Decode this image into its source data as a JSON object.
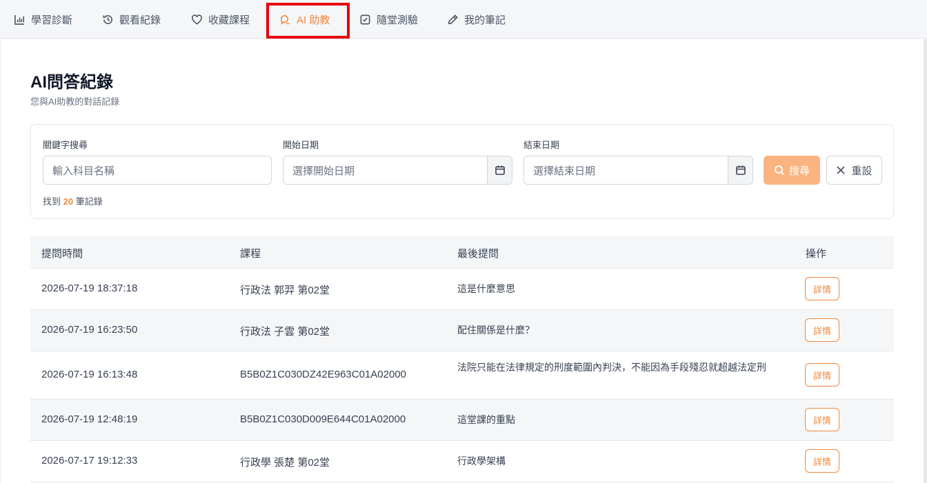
{
  "tabs": [
    {
      "label": "學習診斷",
      "icon": "bar-chart-icon",
      "active": false
    },
    {
      "label": "觀看紀錄",
      "icon": "history-icon",
      "active": false
    },
    {
      "label": "收藏課程",
      "icon": "heart-icon",
      "active": false
    },
    {
      "label": "AI 助教",
      "icon": "chat-icon",
      "active": true
    },
    {
      "label": "隨堂測驗",
      "icon": "checkbox-icon",
      "active": false
    },
    {
      "label": "我的筆記",
      "icon": "pencil-icon",
      "active": false
    }
  ],
  "page": {
    "title": "AI問答紀錄",
    "subtitle": "您與AI助教的對話記錄"
  },
  "filter": {
    "keyword_label": "關鍵字搜尋",
    "keyword_placeholder": "輸入科目名稱",
    "start_label": "開始日期",
    "start_placeholder": "選擇開始日期",
    "end_label": "結束日期",
    "end_placeholder": "選擇結束日期",
    "search_label": "搜尋",
    "reset_label": "重設",
    "result_prefix": "找到",
    "result_count": "20",
    "result_suffix": "筆記錄"
  },
  "table": {
    "headers": [
      "提問時間",
      "課程",
      "最後提問",
      "操作"
    ],
    "detail_label": "詳情",
    "rows": [
      {
        "time": "2026-07-19 18:37:18",
        "course": "行政法 郭羿 第02堂",
        "question": "這是什麼意思"
      },
      {
        "time": "2026-07-19 16:23:50",
        "course": "行政法 子雲 第02堂",
        "question": "配住關係是什麼？"
      },
      {
        "time": "2026-07-19 16:13:48",
        "course": "B5B0Z1C030DZ42E963C01A02000",
        "question": "法院只能在法律規定的刑度範圍內判決，不能因為手段殘忍就超越法定刑"
      },
      {
        "time": "2026-07-19 12:48:19",
        "course": "B5B0Z1C030D009E644C01A02000",
        "question": "這堂課的重點"
      },
      {
        "time": "2026-07-17 19:12:33",
        "course": "行政學 張楚 第02堂",
        "question": "行政學架構"
      }
    ]
  },
  "colors": {
    "accent": "#f0883e",
    "search_button": "#fbb47f",
    "highlight_box": "#e8000b"
  }
}
